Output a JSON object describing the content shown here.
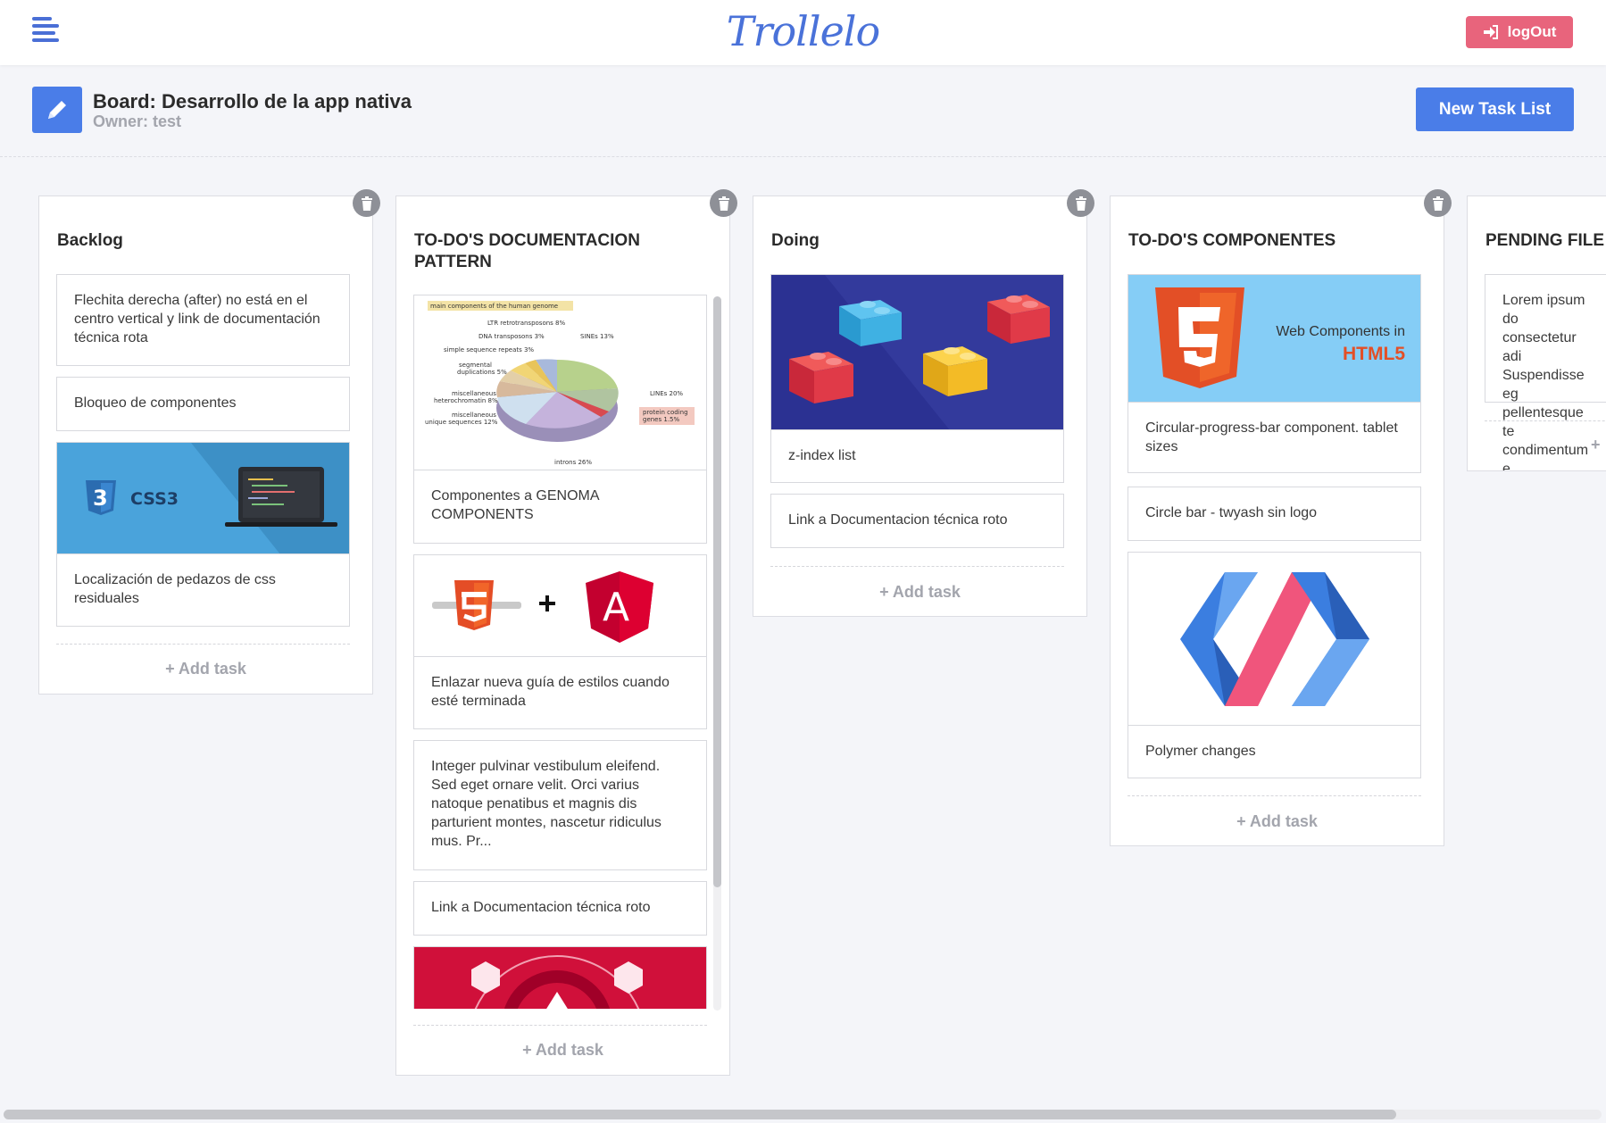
{
  "app": {
    "logo": "Trollelo",
    "logout_label": "logOut"
  },
  "board": {
    "title": "Board: Desarrollo de la app nativa",
    "owner": "Owner: test",
    "new_list_label": "New Task List"
  },
  "add_task_label": "+ Add task",
  "lists": [
    {
      "title": "Backlog",
      "cards": [
        {
          "text": "Flechita derecha (after) no está en el centro vertical y link de documentación técnica rota"
        },
        {
          "text": "Bloqueo de componentes"
        },
        {
          "text": "Localización de pedazos de css residuales",
          "image": "css3-laptop",
          "image_label": "CSS3"
        }
      ]
    },
    {
      "title": "TO-DO'S DOCUMENTACION PATTERN",
      "cards": [
        {
          "text": "Componentes a GENOMA COMPONENTS",
          "image": "genome-pie-chart",
          "chart_labels": [
            "main components of the human genome",
            "LTR retrotransposons 8%",
            "DNA transposons 3%",
            "simple sequence repeats 3%",
            "segmental duplications 5%",
            "miscellaneous heterochromatin 8%",
            "miscellaneous unique sequences 12%",
            "SINEs 13%",
            "LINEs 20%",
            "protein coding genes 1.5%",
            "introns 26%"
          ]
        },
        {
          "text": "Enlazar nueva guía de estilos cuando esté terminada",
          "image": "html5-plus-angular"
        },
        {
          "text": "Integer pulvinar vestibulum eleifend. Sed eget ornare velit. Orci varius natoque penatibus et magnis dis parturient montes, nascetur ridiculus mus. Pr..."
        },
        {
          "text": "Link a Documentacion técnica roto"
        },
        {
          "text": "",
          "image": "angular-red-banner"
        }
      ]
    },
    {
      "title": "Doing",
      "cards": [
        {
          "text": "z-index list",
          "image": "lego-bricks"
        },
        {
          "text": "Link a Documentacion técnica roto"
        }
      ]
    },
    {
      "title": "TO-DO'S COMPONENTES",
      "cards": [
        {
          "text": "Circular-progress-bar component. tablet sizes",
          "image": "html5-web-components",
          "image_label_1": "Web Components in",
          "image_label_2": "HTML5"
        },
        {
          "text": "Circle bar - twyash sin logo"
        },
        {
          "text": "Polymer changes",
          "image": "polymer-logo"
        }
      ]
    },
    {
      "title": "PENDING FILE",
      "cards": [
        {
          "text": "Lorem ipsum do consectetur adi Suspendisse eg pellentesque te condimentum e"
        }
      ]
    }
  ],
  "colors": {
    "accent": "#4a7de8",
    "logout": "#e8647c",
    "muted": "#a3a5ad"
  }
}
